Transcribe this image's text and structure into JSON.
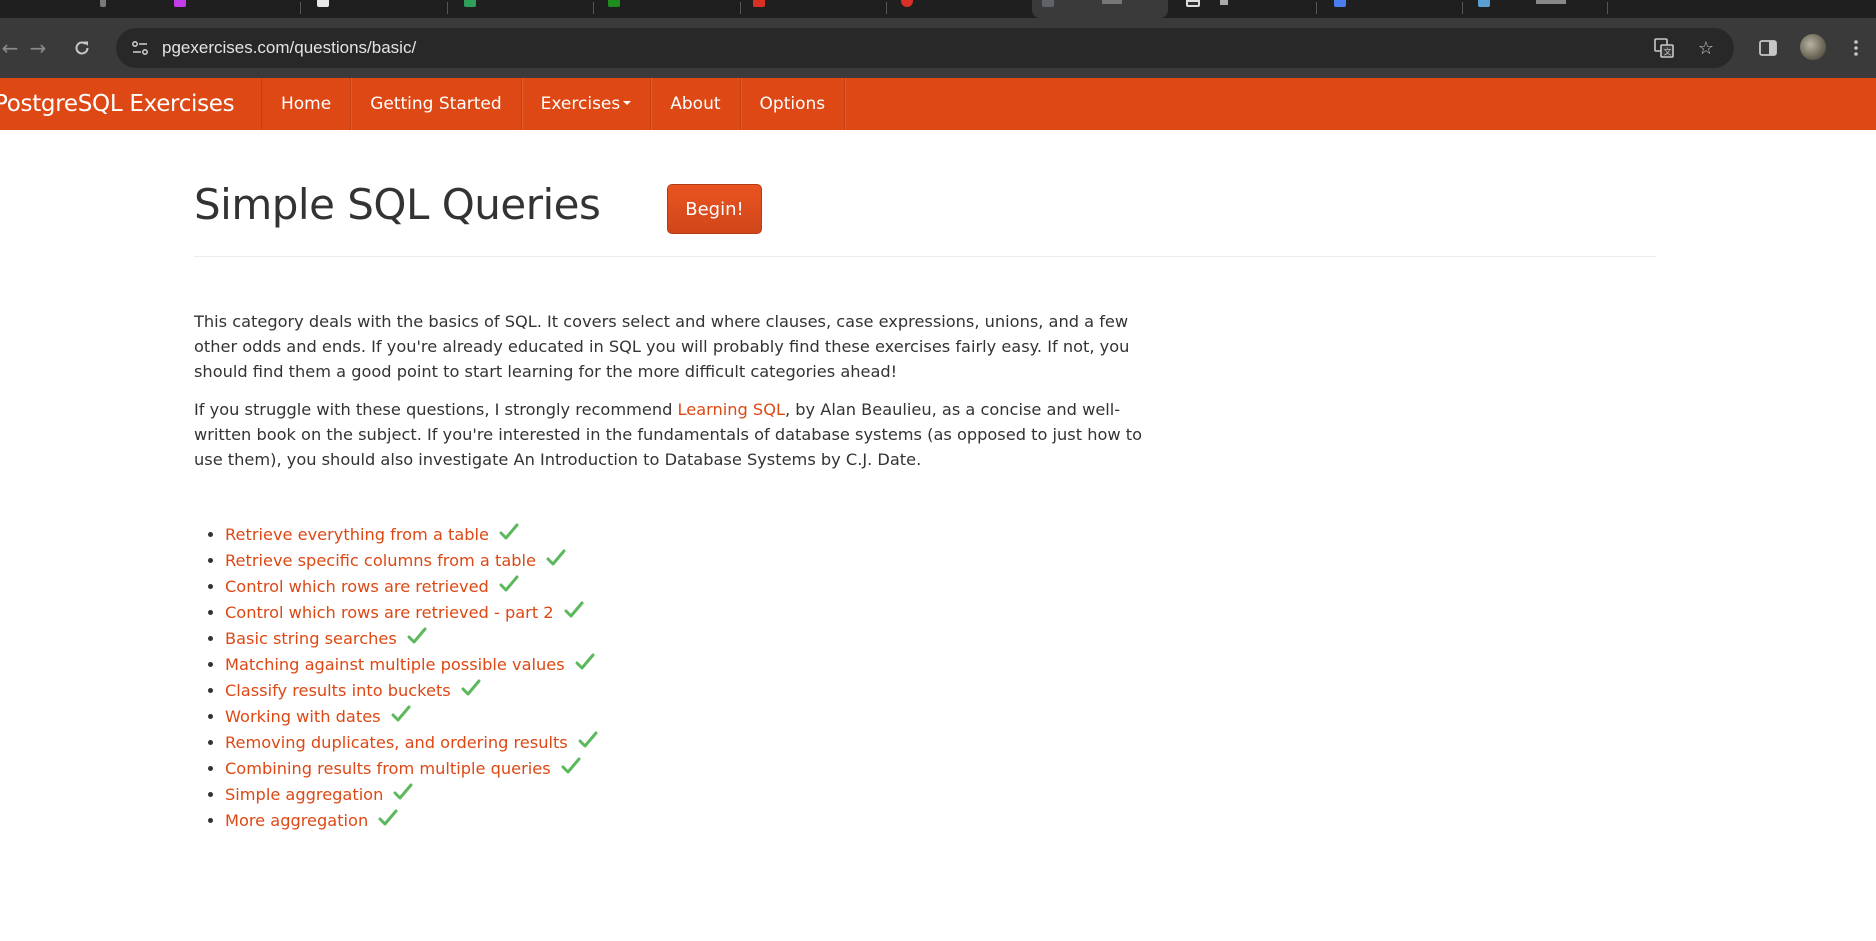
{
  "browser": {
    "url": "pgexercises.com/questions/basic/",
    "tab_favicon_colors": [
      "#7a7a7a",
      "#c23ce8",
      "#e8e8e8",
      "#2f9e5a",
      "#1e8e1e",
      "#d93025",
      "#d93025",
      "#5f6368",
      "#2f2f2f",
      "#4a7df0",
      "#5a9fd4"
    ]
  },
  "site": {
    "brand": "PostgreSQL Exercises",
    "accent_color": "#dd4814",
    "nav": [
      "Home",
      "Getting Started",
      "Exercises",
      "About",
      "Options"
    ]
  },
  "page": {
    "title": "Simple SQL Queries",
    "begin_label": "Begin!",
    "intro_1": "This category deals with the basics of SQL. It covers select and where clauses, case expressions, unions, and a few other odds and ends. If you're already educated in SQL you will probably find these exercises fairly easy. If not, you should find them a good point to start learning for the more difficult categories ahead!",
    "intro_2_before": "If you struggle with these questions, I strongly recommend ",
    "intro_2_link": "Learning SQL",
    "intro_2_after": ", by Alan Beaulieu, as a concise and well-written book on the subject. If you're interested in the fundamentals of database systems (as opposed to just how to use them), you should also investigate An Introduction to Database Systems by C.J. Date.",
    "exercises": [
      "Retrieve everything from a table",
      "Retrieve specific columns from a table",
      "Control which rows are retrieved",
      "Control which rows are retrieved - part 2",
      "Basic string searches",
      "Matching against multiple possible values",
      "Classify results into buckets",
      "Working with dates",
      "Removing duplicates, and ordering results",
      "Combining results from multiple queries",
      "Simple aggregation",
      "More aggregation"
    ],
    "completed_icon": "check-icon",
    "completed_color": "#5cb85c"
  }
}
